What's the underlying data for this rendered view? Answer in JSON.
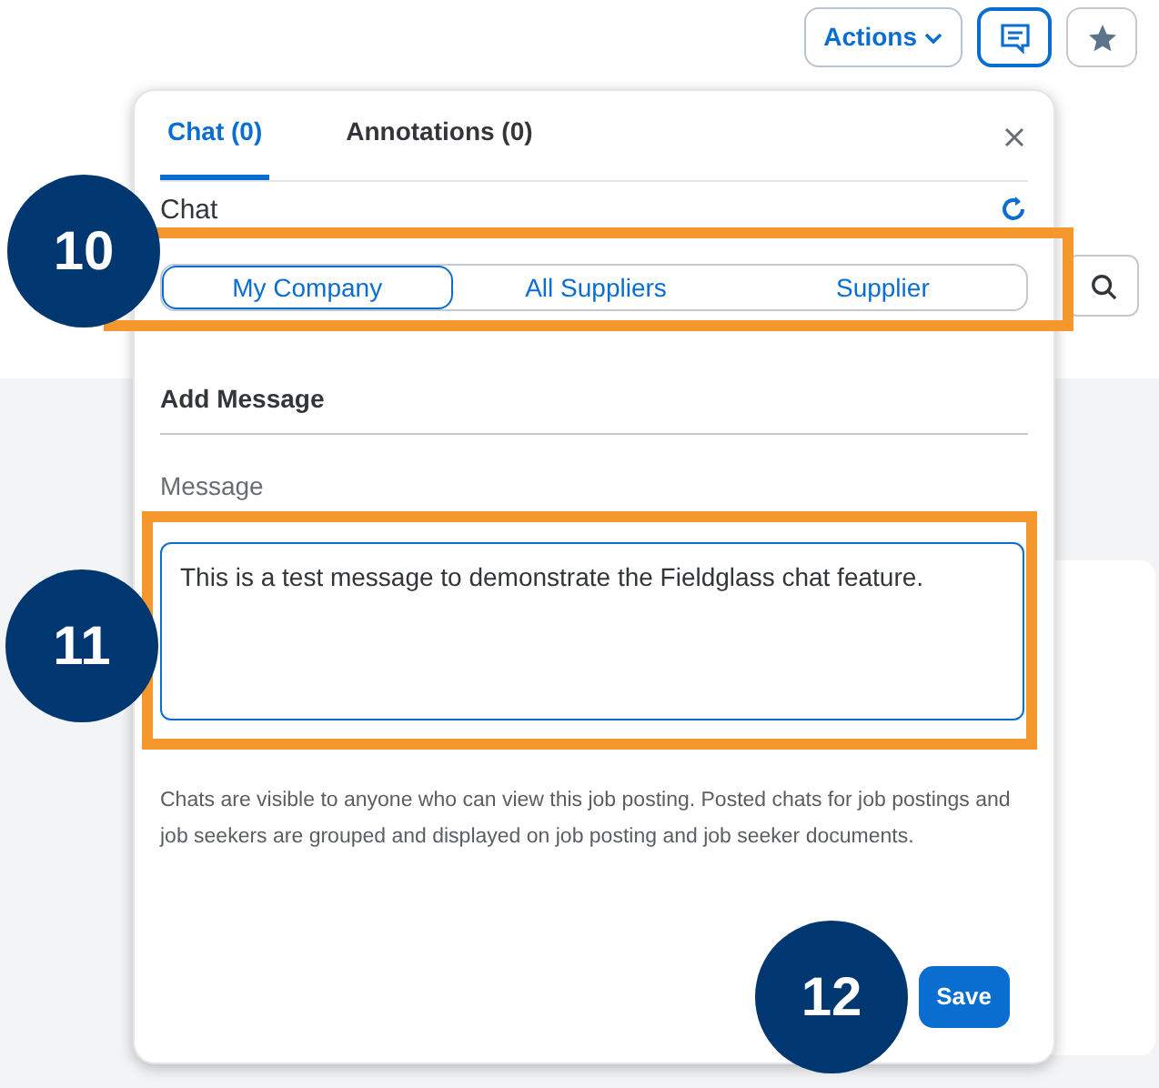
{
  "toolbar": {
    "actions_label": "Actions"
  },
  "popover": {
    "tabs": [
      {
        "label": "Chat (0)",
        "selected": true
      },
      {
        "label": "Annotations (0)",
        "selected": false
      }
    ],
    "section_title": "Chat",
    "audience": [
      {
        "label": "My Company",
        "selected": true
      },
      {
        "label": "All Suppliers",
        "selected": false
      },
      {
        "label": "Supplier",
        "selected": false
      }
    ],
    "add_message_title": "Add Message",
    "message_label": "Message",
    "message_value": "This is a test message to demonstrate the Fieldglass chat feature.",
    "note": "Chats are visible to anyone who can view this job posting. Posted chats for job postings and job seekers are grouped and displayed on job posting and job seeker documents.",
    "save_label": "Save"
  },
  "callouts": [
    "10",
    "11",
    "12"
  ]
}
